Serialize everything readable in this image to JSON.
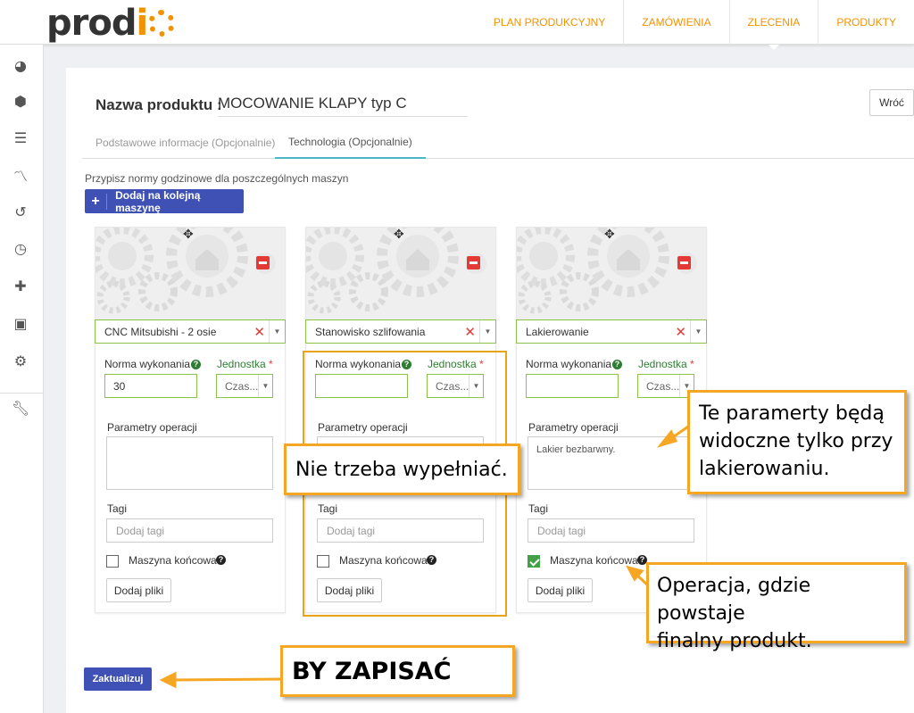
{
  "header": {
    "logo_text": "prod",
    "logo_letter": "i",
    "nav": [
      "PLAN PRODUKCYJNY",
      "ZAMÓWIENIA",
      "ZLECENIA",
      "PRODUKTY"
    ]
  },
  "sidebar": {
    "icons": [
      "dashboard-icon",
      "cubes-icon",
      "list-icon",
      "chart-icon",
      "history-icon",
      "clock-icon",
      "puzzle-icon",
      "briefcase-icon",
      "gears-icon",
      "wrench-icon"
    ]
  },
  "product": {
    "name_label": "Nazwa produktu :",
    "name_value": "MOCOWANIE KLAPY typ C",
    "back_label": "Wróć"
  },
  "tabs": [
    "Podstawowe informacje (Opcjonalnie)",
    "Technologia (Opcjonalnie)"
  ],
  "technology": {
    "hint": "Przypisz normy godzinowe dla poszczególnych maszyn",
    "add_machine_label": "Dodaj na kolejną maszynę",
    "update_label": "Zaktualizuj"
  },
  "card_labels": {
    "norm": "Norma wykonania",
    "unit": "Jednostka",
    "required": "*",
    "params": "Parametry operacji",
    "tags": "Tagi",
    "tags_placeholder": "Dodaj tagi",
    "final_machine": "Maszyna końcowa",
    "files": "Dodaj pliki",
    "unit_value": "Czas..."
  },
  "cards": [
    {
      "machine": "CNC Mitsubishi - 2 osie",
      "norm": "30",
      "params": "",
      "final": false
    },
    {
      "machine": "Stanowisko szlifowania",
      "norm": "",
      "params": "",
      "final": false
    },
    {
      "machine": "Lakierowanie",
      "norm": "",
      "params": "Lakier bezbarwny.",
      "final": true
    }
  ],
  "annotations": {
    "params_note": [
      "Te paramerty będą",
      "widoczne tylko przy",
      "lakierowaniu."
    ],
    "optional_note": "Nie trzeba wypełniać.",
    "final_note": [
      "Operacja, gdzie powstaje",
      "finalny produkt."
    ],
    "save_note": "BY ZAPISAĆ"
  },
  "colors": {
    "brand_orange": "#f39200",
    "primary_blue": "#3f51b5",
    "valid_green": "#8bc34a",
    "danger_red": "#e53935",
    "callout_border": "#f5a623"
  }
}
